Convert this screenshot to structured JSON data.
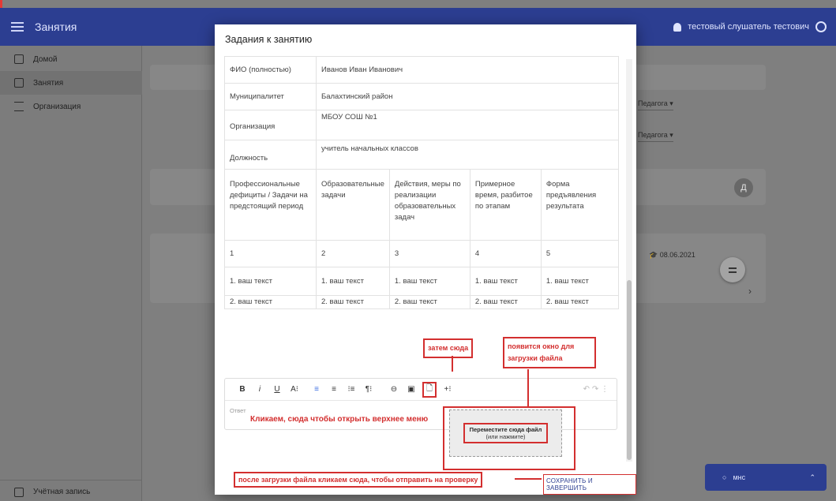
{
  "app": {
    "title": "Занятия",
    "user_name": "тестовый слушатель тестович"
  },
  "sidebar": {
    "items": [
      {
        "label": "Домой",
        "icon": "home-icon"
      },
      {
        "label": "Занятия",
        "icon": "book-icon"
      },
      {
        "label": "Организация",
        "icon": "list-icon"
      }
    ],
    "bottom_item": {
      "label": "Учётная запись",
      "icon": "account-icon"
    }
  },
  "background": {
    "select_1": "Педагога ▾",
    "select_2": "Педагога ▾",
    "avatar_letter": "Д",
    "date": "08.06.2021",
    "chat_label": "мнс"
  },
  "dialog": {
    "title": "Задания к занятию",
    "info_rows": [
      {
        "label": "ФИО (полностью)",
        "value": "Иванов Иван Иванович"
      },
      {
        "label": "Муниципалитет",
        "value": "Балахтинский район"
      },
      {
        "label": "Организация",
        "value": "МБОУ СОШ №1"
      },
      {
        "label": "Должность",
        "value": "учитель начальных классов"
      }
    ],
    "plan_headers": [
      "Профессиональные дефициты / Задачи на предстоящий период",
      "Образовательные задачи",
      "Действия, меры по реализации образовательных задач",
      "Примерное время, разбитое по этапам",
      "Форма предъявления результата"
    ],
    "plan_numbers": [
      "1",
      "2",
      "3",
      "4",
      "5"
    ],
    "plan_row_1": [
      "1. ваш текст",
      "1. ваш текст",
      "1. ваш текст",
      "1. ваш текст",
      "1. ваш текст"
    ],
    "plan_row_2": [
      "2. ваш текст",
      "2. ваш текст",
      "2. ваш текст",
      "2. ваш текст",
      "2. ваш текст"
    ],
    "toolbar": [
      "B",
      "i",
      "U",
      "A⁝",
      "≡",
      "≡",
      "⁝≡",
      "¶⁝",
      "⊖",
      "▣",
      "🗋",
      "+⁝"
    ],
    "answer_placeholder": "Ответ",
    "save_label": "СОХРАНИТЬ И ЗАВЕРШИТЬ"
  },
  "annotations": {
    "then_here": "затем сюда",
    "window_appears": "появится окно для загрузки файла",
    "click_here": "Кликаем, сюда чтобы открыть верхнее меню",
    "after_upload": "после загрузки файла кликаем сюда, чтобы отправить на проверку",
    "drop_title": "Переместите сюда файл",
    "drop_sub": "(или нажмите)"
  }
}
